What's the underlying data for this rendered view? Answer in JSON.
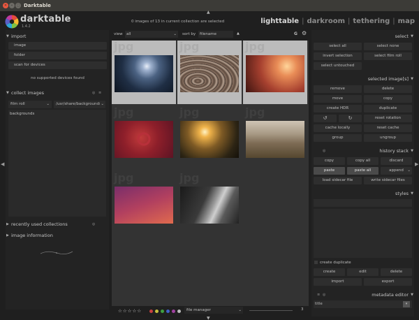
{
  "window": {
    "title": "Darktable"
  },
  "app": {
    "name": "darktable",
    "version": "1.4.2"
  },
  "header": {
    "selection_info": "0 images of 13 in current collection are selected",
    "views": [
      "lighttable",
      "darkroom",
      "tethering",
      "map"
    ],
    "view_separator": "|"
  },
  "left": {
    "import": {
      "title": "import",
      "buttons": [
        "image",
        "folder",
        "scan for devices"
      ],
      "status": "no supported devices found"
    },
    "collect": {
      "title": "collect images",
      "property": "film roll",
      "path": "/usr/share/backgrounds",
      "items": [
        "backgrounds"
      ]
    },
    "recent": {
      "title": "recently used collections"
    },
    "image_info": {
      "title": "image information"
    }
  },
  "center": {
    "view_label": "view",
    "view_value": "all",
    "sort_label": "sort by",
    "sort_value": "filename",
    "sort_direction_icon": "triangle-up",
    "grouping": "G",
    "watermark": "jpg",
    "layout": "file manager",
    "zoom": "3"
  },
  "right": {
    "select": {
      "title": "select",
      "buttons": [
        "select all",
        "select none",
        "invert selection",
        "select film roll",
        "select untouched"
      ]
    },
    "selected_images": {
      "title": "selected image[s]",
      "buttons": [
        "remove",
        "delete",
        "move",
        "copy",
        "create HDR",
        "duplicate",
        "reset rotation",
        "cache locally",
        "reset cache",
        "group",
        "ungroup"
      ]
    },
    "history": {
      "title": "history stack",
      "buttons": [
        "copy",
        "copy all",
        "discard",
        "paste",
        "paste all"
      ],
      "mode": "append",
      "load": "load sidecar file",
      "write": "write sidecar files"
    },
    "styles": {
      "title": "styles",
      "create_duplicate": "create duplicate",
      "buttons": [
        "create",
        "edit",
        "delete",
        "import",
        "export"
      ]
    },
    "metadata": {
      "title": "metadata editor",
      "field": "title"
    }
  },
  "colors": {
    "accent_red": "#c9312b",
    "labels": [
      "#c84040",
      "#c8c040",
      "#40a040",
      "#4060c8",
      "#a040a0",
      "#bbbbbb"
    ]
  }
}
